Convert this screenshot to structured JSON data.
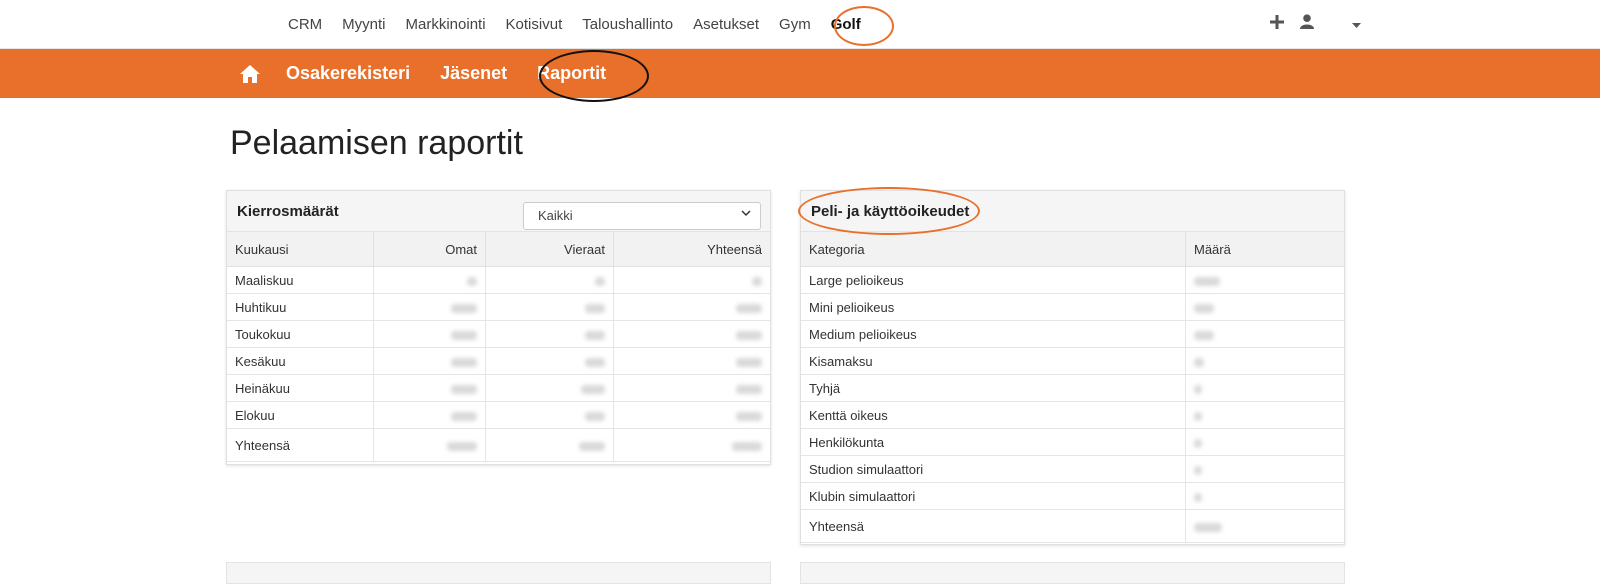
{
  "topnav": {
    "items": [
      "CRM",
      "Myynti",
      "Markkinointi",
      "Kotisivut",
      "Taloushallinto",
      "Asetukset",
      "Gym",
      "Golf"
    ],
    "active": "Golf",
    "icons": [
      "plus-icon",
      "user-icon",
      "caret-down-icon"
    ]
  },
  "subnav": {
    "home_icon": "home-icon",
    "items": [
      "Osakerekisteri",
      "Jäsenet",
      "Raportit"
    ],
    "active": "Raportit"
  },
  "page": {
    "title": "Pelaamisen raportit"
  },
  "rounds": {
    "title": "Kierrosmäärät",
    "filter_value": "Kaikki",
    "columns": [
      "Kuukausi",
      "Omat",
      "Vieraat",
      "Yhteensä"
    ],
    "rows": [
      {
        "label": "Maaliskuu"
      },
      {
        "label": "Huhtikuu"
      },
      {
        "label": "Toukokuu"
      },
      {
        "label": "Kesäkuu"
      },
      {
        "label": "Heinäkuu"
      },
      {
        "label": "Elokuu"
      }
    ],
    "total_label": "Yhteensä"
  },
  "rights": {
    "title": "Peli- ja käyttöoikeudet",
    "columns": [
      "Kategoria",
      "Määrä"
    ],
    "rows": [
      {
        "label": "Large pelioikeus"
      },
      {
        "label": "Mini pelioikeus"
      },
      {
        "label": "Medium pelioikeus"
      },
      {
        "label": "Kisamaksu"
      },
      {
        "label": "Tyhjä"
      },
      {
        "label": "Kenttä oikeus"
      },
      {
        "label": "Henkilökunta"
      },
      {
        "label": "Studion simulaattori"
      },
      {
        "label": "Klubin simulaattori"
      }
    ],
    "total_label": "Yhteensä"
  },
  "colors": {
    "accent": "#e8702a",
    "annotation_orange": "#e8702a",
    "annotation_black": "#111111"
  }
}
